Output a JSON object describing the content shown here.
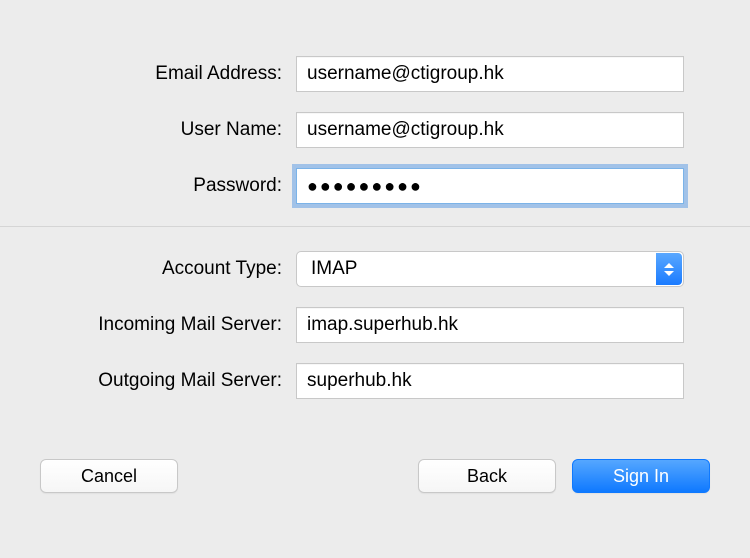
{
  "top": {
    "email": {
      "label": "Email Address:",
      "value": "username@ctigroup.hk"
    },
    "username": {
      "label": "User Name:",
      "value": "username@ctigroup.hk"
    },
    "password": {
      "label": "Password:",
      "value": "●●●●●●●●●"
    }
  },
  "bottom": {
    "account_type": {
      "label": "Account Type:",
      "value": "IMAP"
    },
    "incoming": {
      "label": "Incoming Mail Server:",
      "value": "imap.superhub.hk"
    },
    "outgoing": {
      "label": "Outgoing Mail Server:",
      "value": "superhub.hk"
    }
  },
  "buttons": {
    "cancel": "Cancel",
    "back": "Back",
    "signin": "Sign In"
  }
}
